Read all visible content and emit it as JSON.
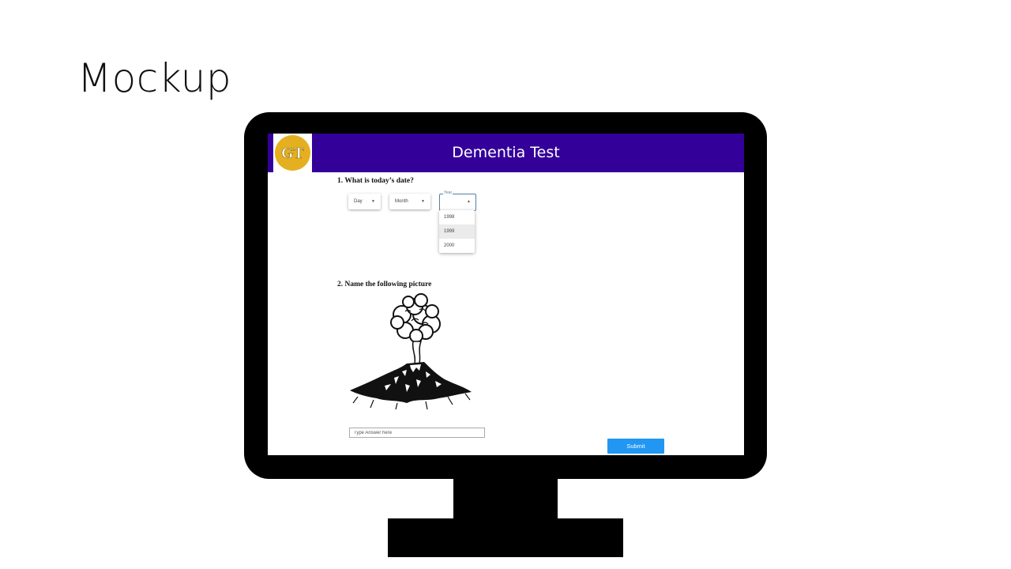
{
  "slide": {
    "title": "Mockup"
  },
  "app": {
    "title": "Dementia Test",
    "logo_text": "GT",
    "header_color": "#330099"
  },
  "question1": {
    "text": "1.  What is today’s date?",
    "day_label": "Day",
    "month_label": "Month",
    "year_label": "Year",
    "year_options": [
      "1998",
      "1999",
      "2000"
    ],
    "highlighted_year": "1999"
  },
  "question2": {
    "text": "2.  Name the following picture",
    "picture_icon": "volcano-icon",
    "answer_placeholder": "Type Answer here"
  },
  "submit": {
    "label": "Submit",
    "color": "#2196f3"
  }
}
